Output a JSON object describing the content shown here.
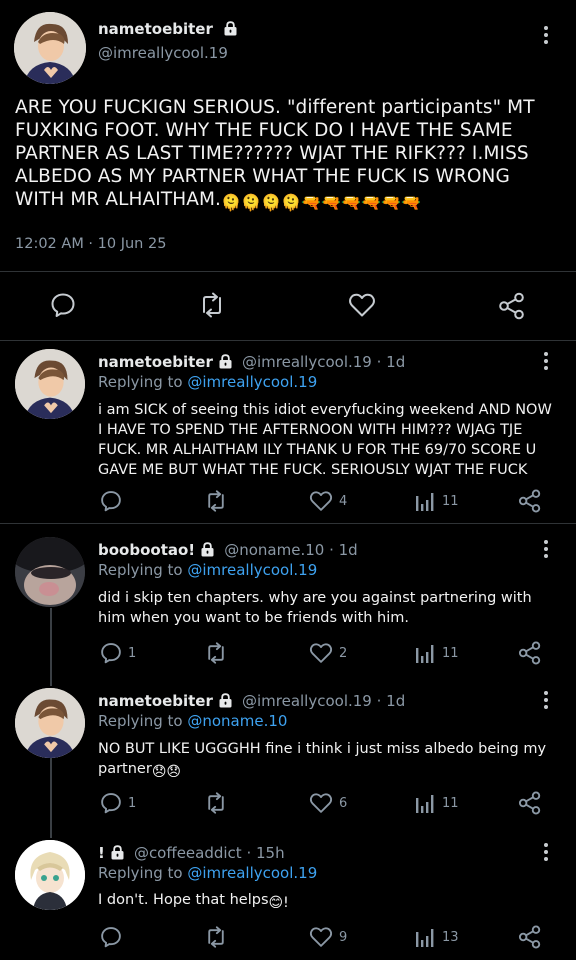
{
  "main_post": {
    "author_name": "nametoebiter",
    "handle": "@imreallycool.19",
    "text": "ARE YOU FUCKIGN SERIOUS. \"different participants\" MT FUXKING FOOT. WHY THE FUCK DO I HAVE THE SAME PARTNER AS LAST TIME?????? WJAT THE RIFK??? I.MISS ALBEDO AS MY PARTNER WHAT THE FUCK IS WRONG WITH MR ALHAITHAM.",
    "emoji_tail": "🫠🫠🫠🫠🔫🔫🔫🔫🔫🔫",
    "timestamp": "12:02 AM · 10 Jun 25"
  },
  "replies": [
    {
      "author_name": "nametoebiter",
      "handle": "@imreallycool.19 · 1d",
      "replying_label": "Replying to",
      "replying_to": "@imreallycool.19",
      "text": "i am SICK of seeing this idiot everyfucking weekend AND NOW I HAVE TO SPEND THE AFTERNOON WITH HIM??? WJAG TJE FUCK. MR ALHAITHAM ILY THANK U FOR THE 69/70 SCORE U GAVE ME BUT WHAT THE FUCK. SERIOUSLY WJAT THE FUCK",
      "reply_count": "",
      "like_count": "4",
      "view_count": "11"
    },
    {
      "author_name": "boobootao!",
      "handle": "@noname.10 · 1d",
      "replying_label": "Replying to",
      "replying_to": "@imreallycool.19",
      "text": "did i skip ten chapters. why are you against partnering with him when you want to be friends with him.",
      "reply_count": "1",
      "like_count": "2",
      "view_count": "11"
    },
    {
      "author_name": "nametoebiter",
      "handle": "@imreallycool.19 · 1d",
      "replying_label": "Replying to",
      "replying_to": "@noname.10",
      "text": "NO BUT LIKE UGGGHH fine i think i just miss albedo being my partner",
      "emoji_tail": "😞😞",
      "reply_count": "1",
      "like_count": "6",
      "view_count": "11"
    },
    {
      "author_name": "!",
      "handle": "@coffeeaddict · 15h",
      "replying_label": "Replying to",
      "replying_to": "@imreallycool.19",
      "text": "I don't. Hope that helps",
      "emoji_tail": "😊!",
      "reply_count": "",
      "like_count": "9",
      "view_count": "13"
    }
  ],
  "icons": {
    "reply": "speech-bubble-icon",
    "repost": "repost-arrows-icon",
    "like": "heart-icon",
    "views": "bar-chart-icon",
    "share": "share-nodes-icon",
    "more": "kebab-menu-icon",
    "lock": "lock-icon"
  },
  "colors": {
    "background": "#000000",
    "text": "#e7e9ea",
    "muted": "#8b98a5",
    "link": "#3ea2f0",
    "separator": "#2f3336"
  }
}
